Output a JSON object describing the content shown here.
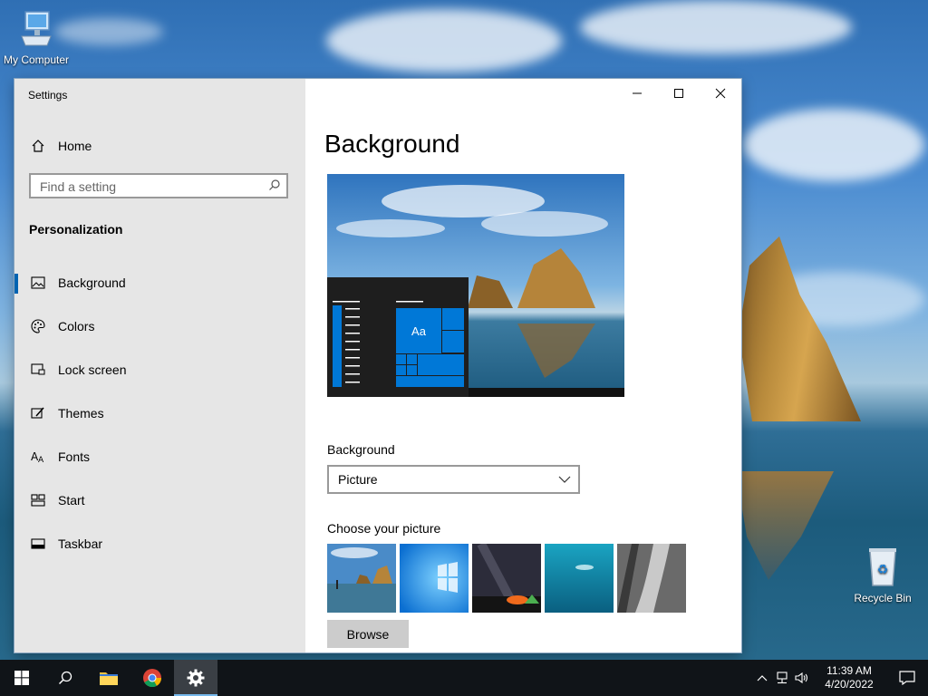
{
  "desktop": {
    "icons": [
      {
        "label": "My Computer"
      },
      {
        "label": "Recycle Bin"
      }
    ]
  },
  "window": {
    "title": "Settings",
    "controls": {
      "minimize": "minimize-icon",
      "maximize": "maximize-icon",
      "close": "close-icon"
    }
  },
  "sidebar": {
    "home_label": "Home",
    "search_placeholder": "Find a setting",
    "section": "Personalization",
    "items": [
      {
        "label": "Background",
        "icon": "picture-icon",
        "active": true
      },
      {
        "label": "Colors",
        "icon": "palette-icon"
      },
      {
        "label": "Lock screen",
        "icon": "lock-screen-icon"
      },
      {
        "label": "Themes",
        "icon": "themes-icon"
      },
      {
        "label": "Fonts",
        "icon": "fonts-icon"
      },
      {
        "label": "Start",
        "icon": "start-icon"
      },
      {
        "label": "Taskbar",
        "icon": "taskbar-icon"
      }
    ]
  },
  "main": {
    "title": "Background",
    "preview_tile_text": "Aa",
    "background_label": "Background",
    "background_value": "Picture",
    "choose_label": "Choose your picture",
    "browse_label": "Browse"
  },
  "taskbar": {
    "time": "11:39 AM",
    "date": "4/20/2022"
  },
  "colors": {
    "accent": "#0063b1",
    "taskbar": "#101418",
    "sidebar": "#e6e6e6"
  }
}
